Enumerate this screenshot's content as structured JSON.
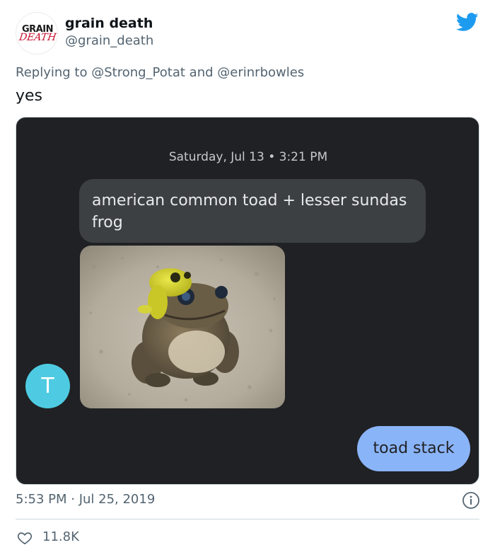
{
  "header": {
    "display_name": "grain death",
    "handle": "@grain_death",
    "avatar_logo_text": "GRAIN DEATH",
    "twitter_icon": "twitter-bird-icon"
  },
  "reply": {
    "prefix": "Replying to",
    "mention_1": "@Strong_Potat",
    "joiner": "and",
    "mention_2": "@erinrbowles"
  },
  "tweet_text": "yes",
  "media": {
    "date_stamp": "Saturday, Jul 13 • 3:21 PM",
    "incoming_message": "american common toad + lesser sundas frog",
    "contact_initial": "T",
    "outgoing_message": "toad stack",
    "photo_description_icon": "frog-photo"
  },
  "footer": {
    "timestamp": "5:53 PM · Jul 25, 2019",
    "like_count": "11.8K",
    "like_icon": "heart-icon",
    "info_icon": "info-icon"
  },
  "colors": {
    "twitter_blue": "#1d9bf0",
    "card_background": "#202124",
    "incoming_bubble": "#3c4043",
    "outgoing_bubble": "#8ab4f8",
    "contact_avatar": "#4ecbe2",
    "muted_text": "#536471"
  }
}
